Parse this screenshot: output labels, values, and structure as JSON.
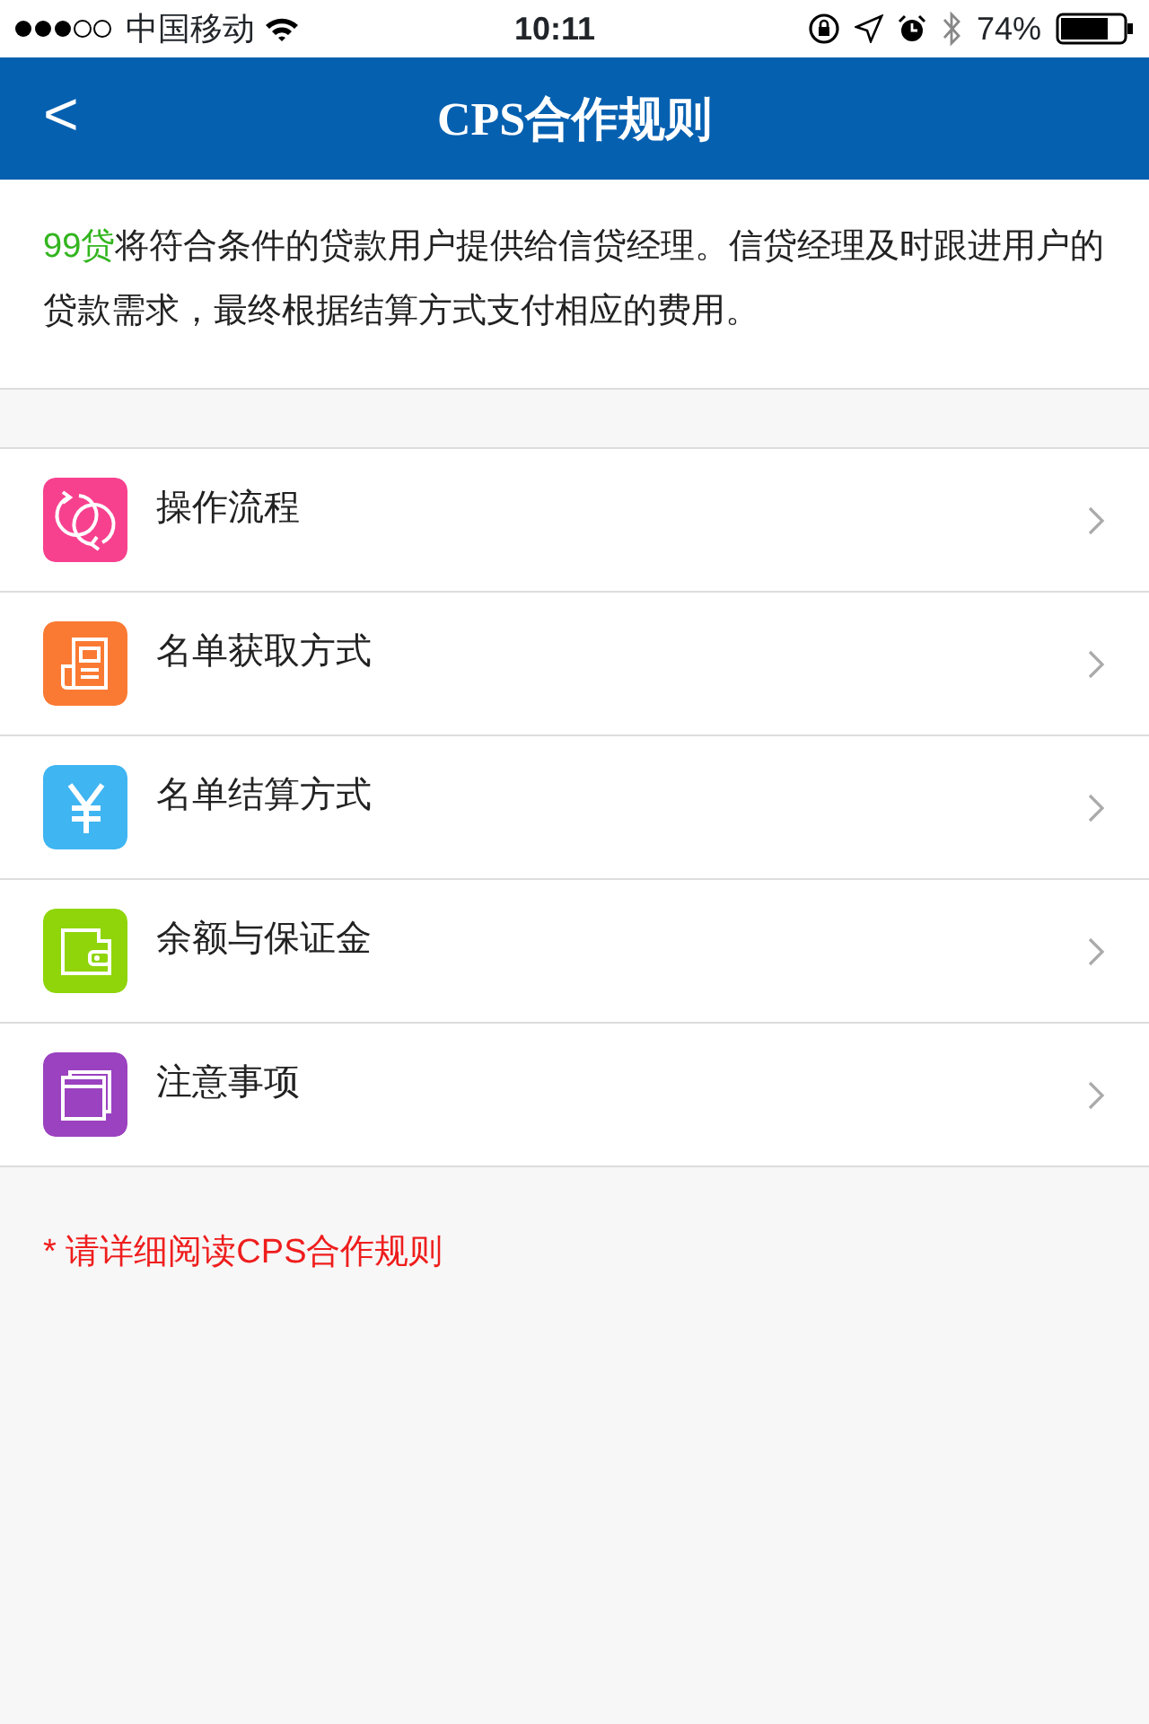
{
  "status_bar": {
    "carrier": "中国移动",
    "time": "10:11",
    "battery": "74%"
  },
  "nav": {
    "back": "<",
    "title": "CPS合作规则"
  },
  "intro": {
    "brand": "99贷",
    "text": "将符合条件的贷款用户提供给信贷经理。信贷经理及时跟进用户的贷款需求，最终根据结算方式支付相应的费用。"
  },
  "menu": [
    {
      "label": "操作流程",
      "kind": "refresh",
      "color": "#f7418f"
    },
    {
      "label": "名单获取方式",
      "kind": "document",
      "color": "#fb7a33"
    },
    {
      "label": "名单结算方式",
      "kind": "yen",
      "color": "#3fb5f2"
    },
    {
      "label": "余额与保证金",
      "kind": "wallet",
      "color": "#8fd50a"
    },
    {
      "label": "注意事项",
      "kind": "window",
      "color": "#9b42c0"
    }
  ],
  "note": "* 请详细阅读CPS合作规则"
}
